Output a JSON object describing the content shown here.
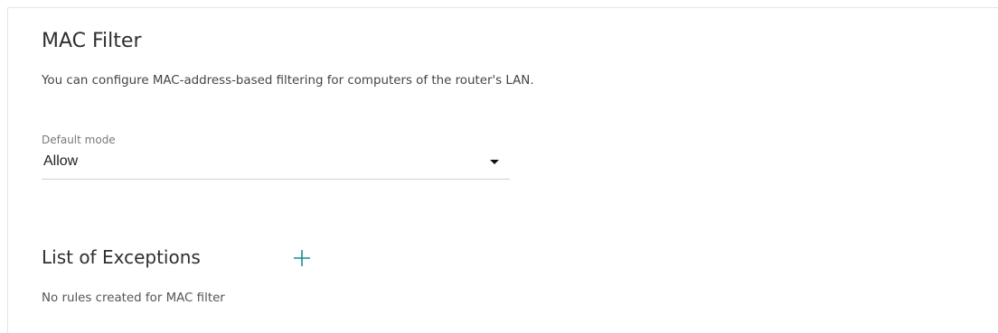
{
  "page": {
    "title": "MAC Filter",
    "description": "You can configure MAC-address-based filtering for computers of the router's LAN."
  },
  "default_mode": {
    "label": "Default mode",
    "value": "Allow",
    "icon": "chevron-down-icon"
  },
  "exceptions": {
    "title": "List of Exceptions",
    "add_icon": "plus-icon",
    "accent_color": "#1f8a8a",
    "empty_message": "No rules created for MAC filter"
  }
}
